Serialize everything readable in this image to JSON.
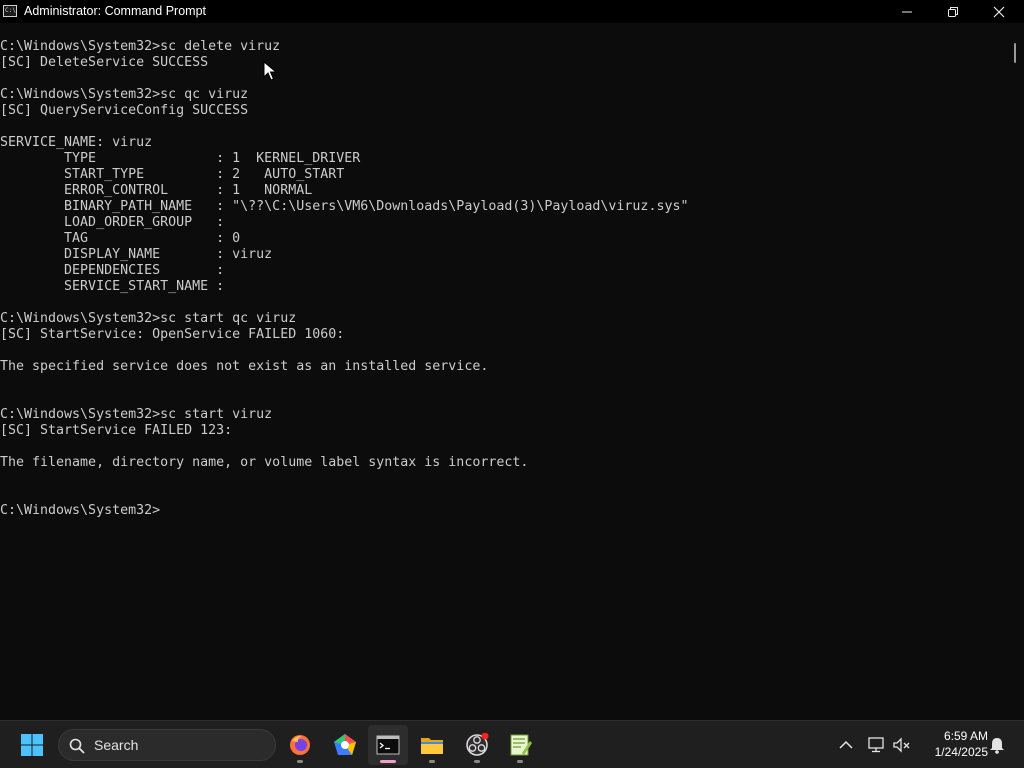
{
  "window": {
    "title": "Administrator: Command Prompt",
    "icon_text": "C:\\"
  },
  "console": {
    "lines": [
      "C:\\Windows\\System32>sc delete viruz",
      "[SC] DeleteService SUCCESS",
      "",
      "C:\\Windows\\System32>sc qc viruz",
      "[SC] QueryServiceConfig SUCCESS",
      "",
      "SERVICE_NAME: viruz",
      "        TYPE               : 1  KERNEL_DRIVER",
      "        START_TYPE         : 2   AUTO_START",
      "        ERROR_CONTROL      : 1   NORMAL",
      "        BINARY_PATH_NAME   : \"\\??\\C:\\Users\\VM6\\Downloads\\Payload(3)\\Payload\\viruz.sys\"",
      "        LOAD_ORDER_GROUP   :",
      "        TAG                : 0",
      "        DISPLAY_NAME       : viruz",
      "        DEPENDENCIES       :",
      "        SERVICE_START_NAME :",
      "",
      "C:\\Windows\\System32>sc start qc viruz",
      "[SC] StartService: OpenService FAILED 1060:",
      "",
      "The specified service does not exist as an installed service.",
      "",
      "",
      "C:\\Windows\\System32>sc start viruz",
      "[SC] StartService FAILED 123:",
      "",
      "The filename, directory name, or volume label syntax is incorrect.",
      "",
      "",
      "C:\\Windows\\System32>"
    ]
  },
  "taskbar": {
    "search_label": "Search",
    "apps": [
      "windows-start-icon",
      "firefox-icon",
      "chromium-browser-icon",
      "command-prompt-icon",
      "file-explorer-icon",
      "obs-studio-icon",
      "notepad-plus-plus-icon"
    ],
    "clock_time": "6:59 AM",
    "clock_date": "1/24/2025",
    "accent": "#0078d4"
  },
  "colors": {
    "console_bg": "#0c0c0c",
    "console_fg": "#cccccc",
    "taskbar_bg": "#1f1f1f"
  }
}
